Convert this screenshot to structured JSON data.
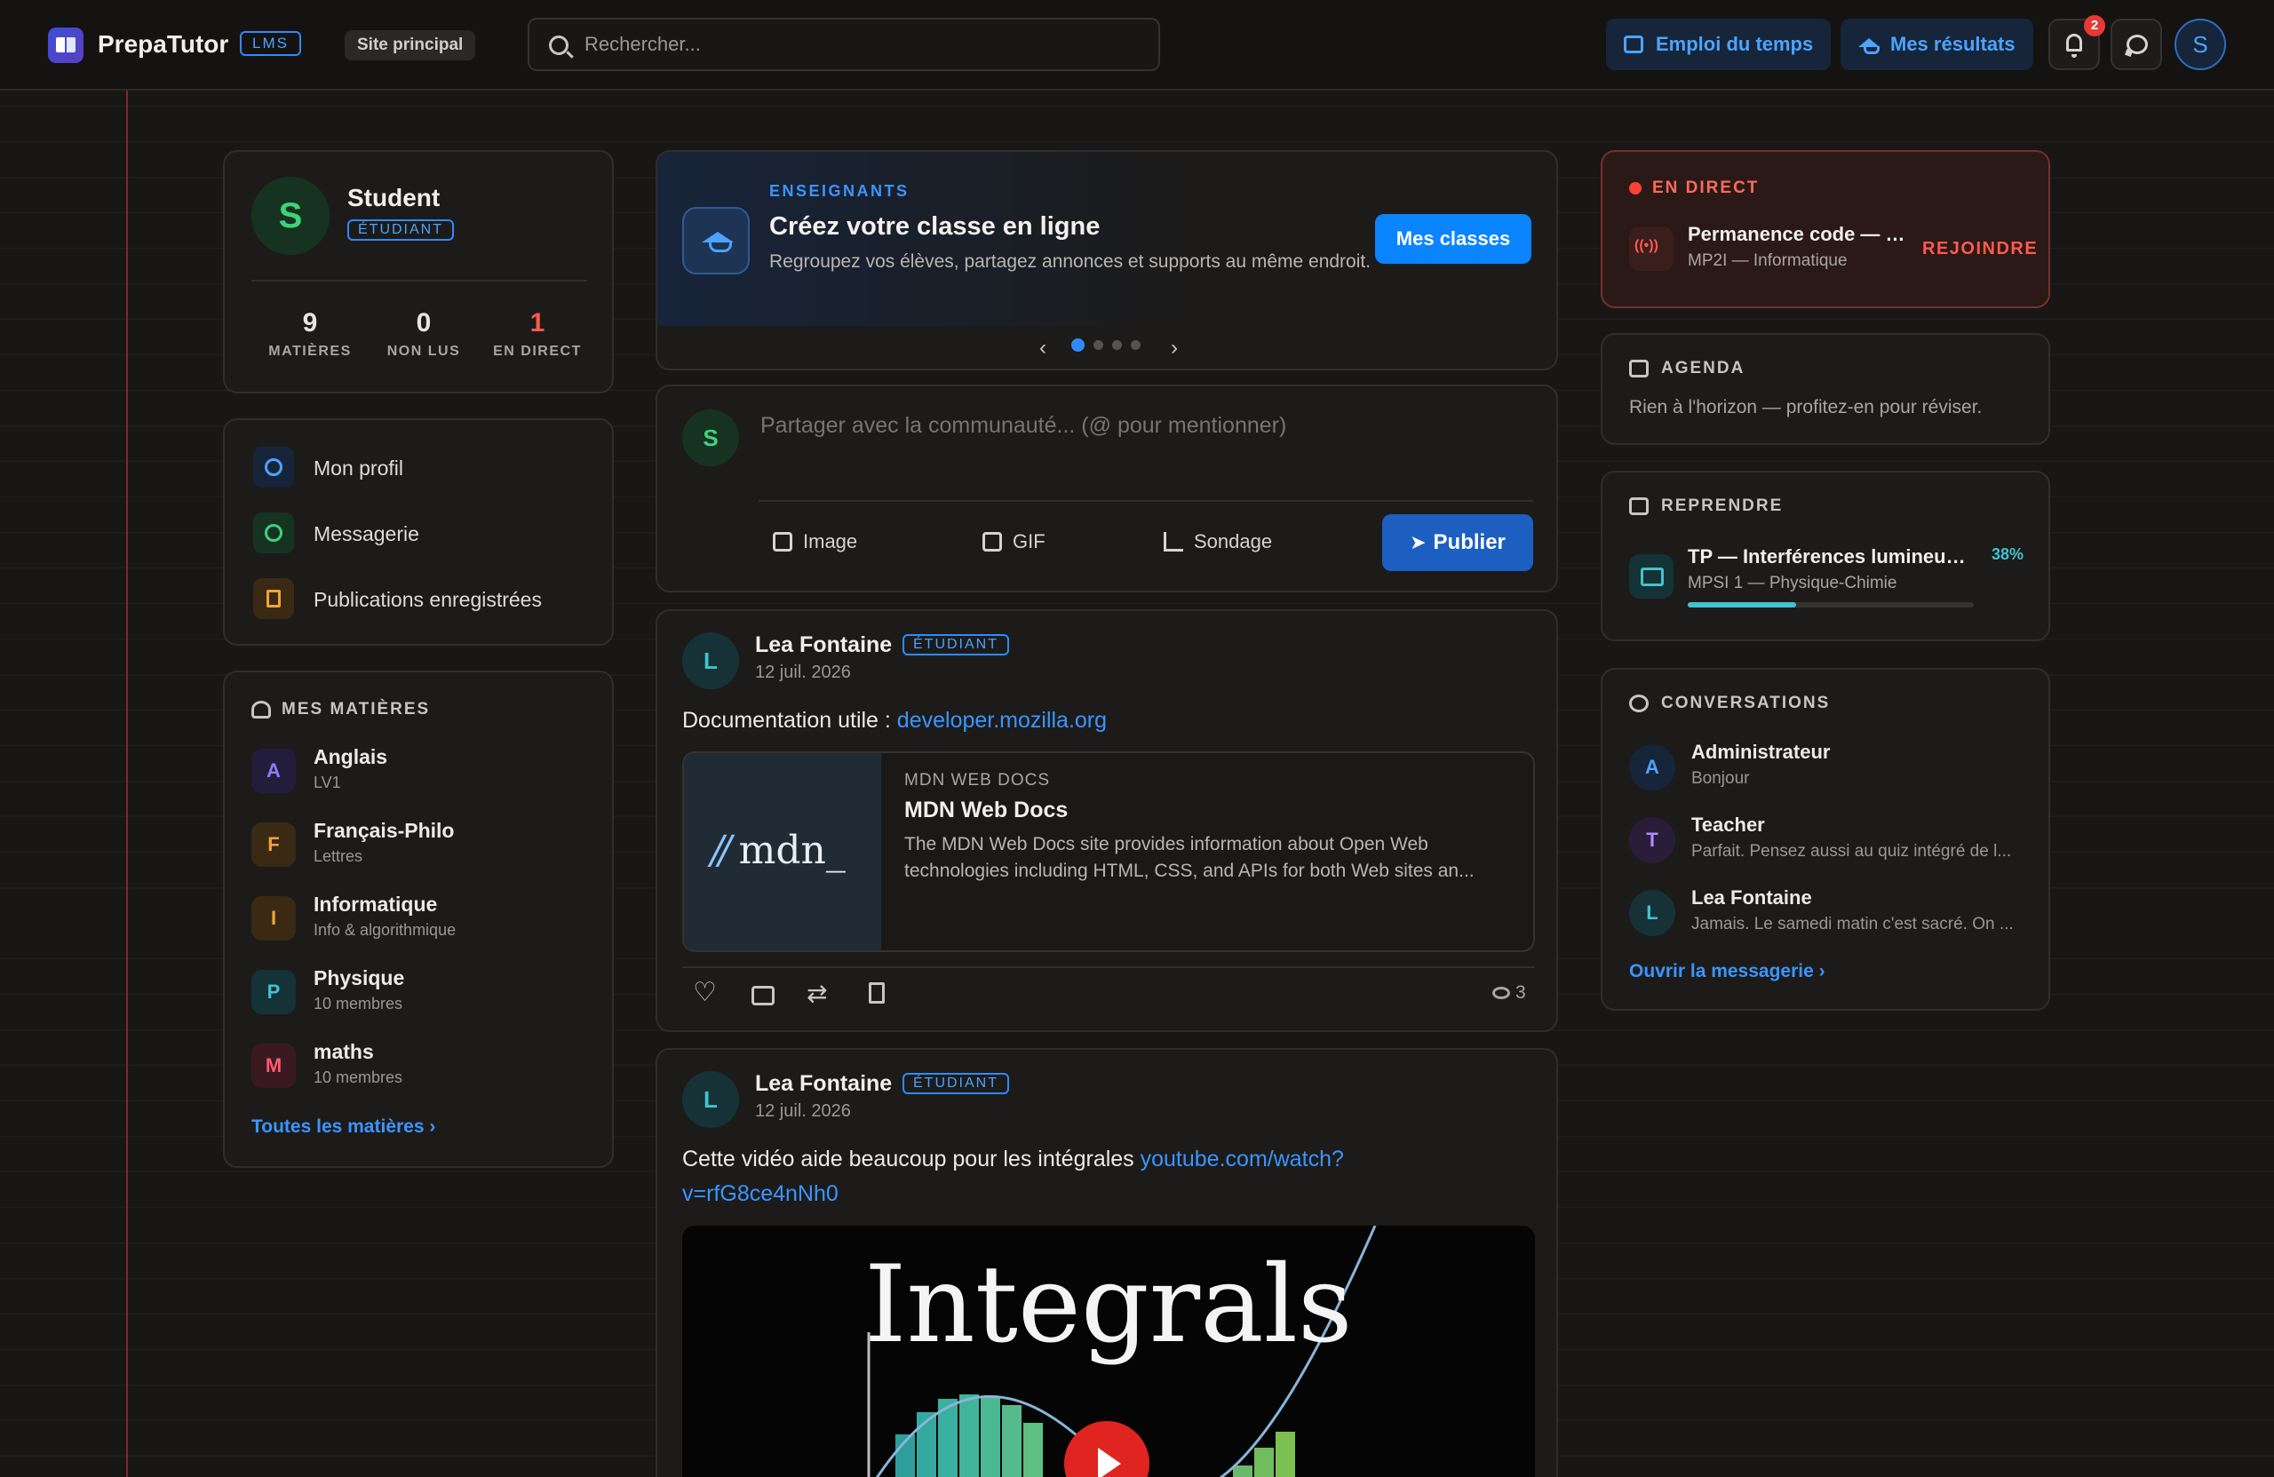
{
  "header": {
    "brand": "PrepaTutor",
    "brand_badge": "LMS",
    "site_pill": "Site principal",
    "search_placeholder": "Rechercher...",
    "schedule_button": "Emploi du temps",
    "results_button": "Mes résultats",
    "notification_count": "2",
    "avatar_initial": "S"
  },
  "profile": {
    "initial": "S",
    "name": "Student",
    "role": "ÉTUDIANT",
    "stats": [
      {
        "value": "9",
        "label": "MATIÈRES"
      },
      {
        "value": "0",
        "label": "NON LUS"
      },
      {
        "value": "1",
        "label": "EN DIRECT"
      }
    ]
  },
  "menu": {
    "items": [
      {
        "label": "Mon profil"
      },
      {
        "label": "Messagerie"
      },
      {
        "label": "Publications enregistrées"
      }
    ]
  },
  "subjects": {
    "title": "MES MATIÈRES",
    "items": [
      {
        "initial": "A",
        "name": "Anglais",
        "sub": "LV1"
      },
      {
        "initial": "F",
        "name": "Français-Philo",
        "sub": "Lettres"
      },
      {
        "initial": "I",
        "name": "Informatique",
        "sub": "Info & algorithmique"
      },
      {
        "initial": "P",
        "name": "Physique",
        "sub": "10 membres"
      },
      {
        "initial": "M",
        "name": "maths",
        "sub": "10 membres"
      }
    ],
    "all_link": "Toutes les matières ›"
  },
  "banner": {
    "kicker": "ENSEIGNANTS",
    "title": "Créez votre classe en ligne",
    "description": "Regroupez vos élèves, partagez annonces et supports au même endroit.",
    "button": "Mes classes",
    "prev": "‹",
    "next": "›"
  },
  "composer": {
    "avatar_initial": "S",
    "placeholder": "Partager avec la communauté... (@ pour mentionner)",
    "tools": [
      "Image",
      "GIF",
      "Sondage"
    ],
    "publish": "Publier"
  },
  "posts": [
    {
      "initial": "L",
      "author": "Lea Fontaine",
      "role": "ÉTUDIANT",
      "date": "12 juil. 2026",
      "text": "Documentation utile : ",
      "link": "developer.mozilla.org",
      "preview": {
        "site": "MDN WEB DOCS",
        "title": "MDN Web Docs",
        "description": "The MDN Web Docs site provides information about Open Web technologies including HTML, CSS, and APIs for both Web sites an...",
        "logo_text": "mdn_"
      },
      "views": "3"
    },
    {
      "initial": "L",
      "author": "Lea Fontaine",
      "role": "ÉTUDIANT",
      "date": "12 juil. 2026",
      "text": "Cette vidéo aide beaucoup pour les intégrales ",
      "link": "youtube.com/watch?v=rfG8ce4nNh0",
      "video_title": "Integrals"
    }
  ],
  "live": {
    "header": "EN DIRECT",
    "title": "Permanence code — s...",
    "subtitle": "MP2I — Informatique",
    "join": "REJOINDRE"
  },
  "agenda": {
    "header": "AGENDA",
    "text": "Rien à l'horizon — profitez-en pour réviser."
  },
  "resume": {
    "header": "REPRENDRE",
    "title": "TP — Interférences lumineus...",
    "subtitle": "MPSI 1 — Physique-Chimie",
    "percent": "38%",
    "progress": 0.38
  },
  "conversations": {
    "header": "CONVERSATIONS",
    "items": [
      {
        "initial": "A",
        "name": "Administrateur",
        "message": "Bonjour"
      },
      {
        "initial": "T",
        "name": "Teacher",
        "message": "Parfait. Pensez aussi au quiz intégré de l..."
      },
      {
        "initial": "L",
        "name": "Lea Fontaine",
        "message": "Jamais. Le samedi matin c'est sacré. On ..."
      }
    ],
    "open_link": "Ouvrir la messagerie ›"
  }
}
